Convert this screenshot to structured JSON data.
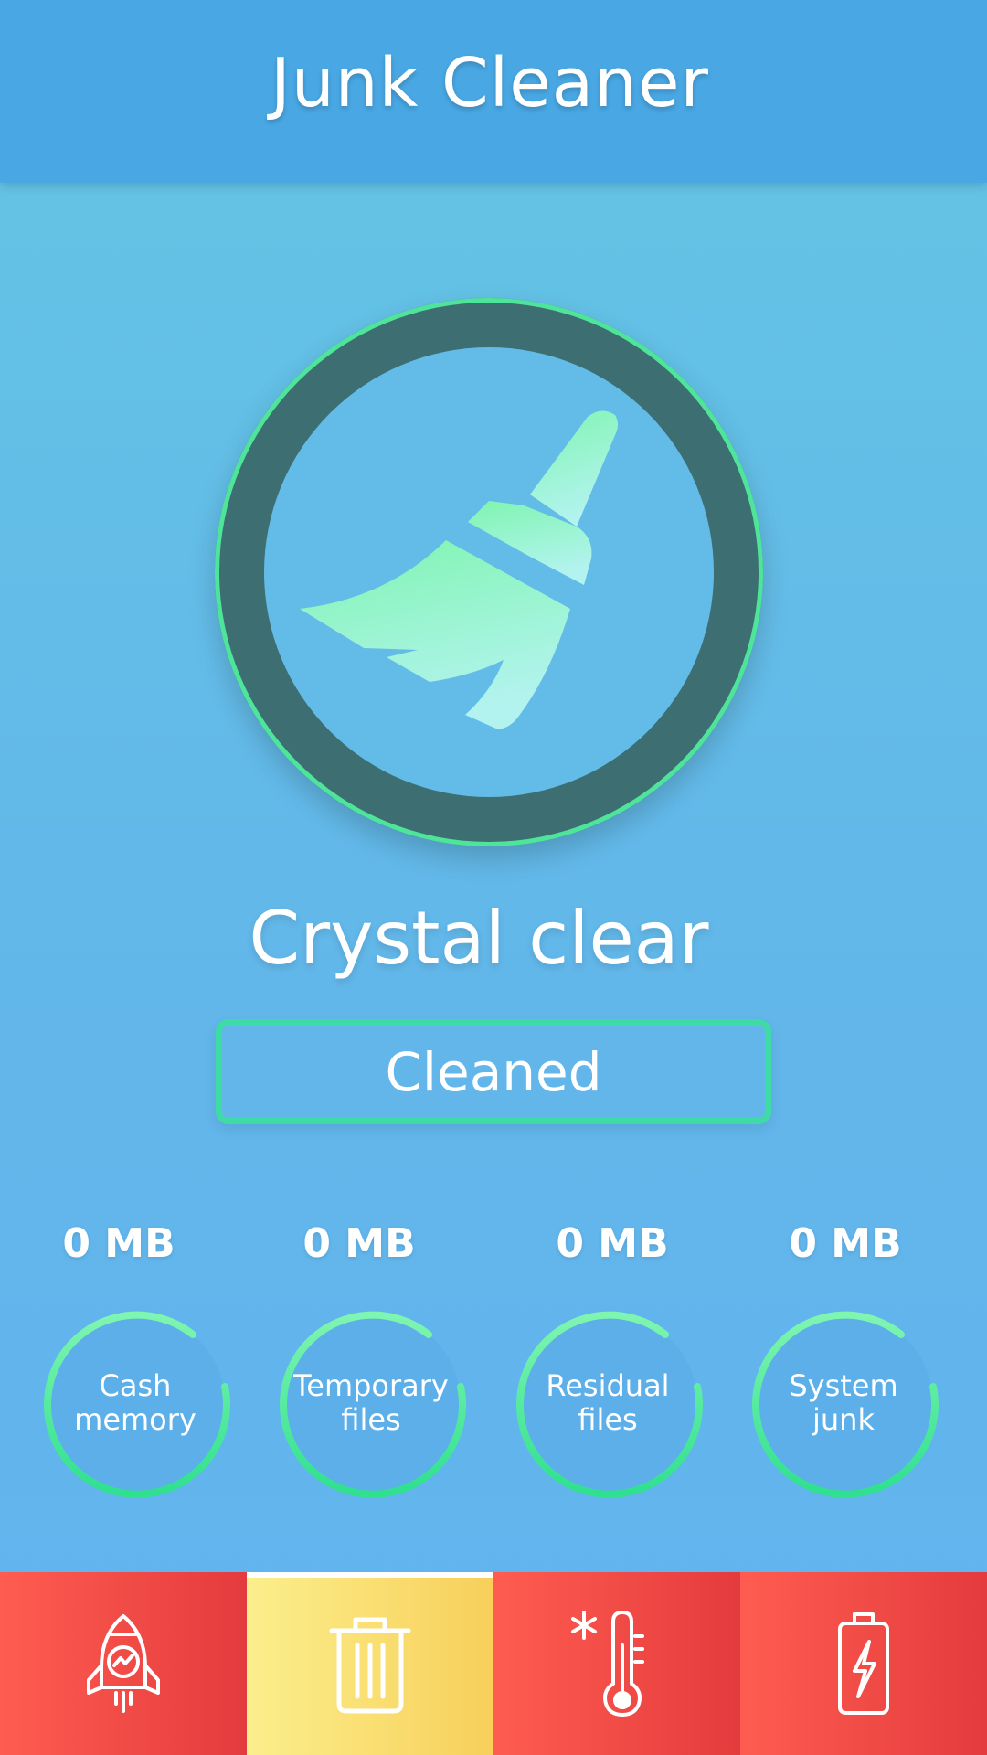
{
  "header": {
    "title": "Junk Cleaner"
  },
  "status": {
    "text": "Crystal clear",
    "button_label": "Cleaned"
  },
  "stats": [
    {
      "value": "0 MB",
      "label_line1": "Cash",
      "label_line2": "memory"
    },
    {
      "value": "0 MB",
      "label_line1": "Temporary",
      "label_line2": "files"
    },
    {
      "value": "0 MB",
      "label_line1": "Residual",
      "label_line2": "files"
    },
    {
      "value": "0 MB",
      "label_line1": "System",
      "label_line2": "junk"
    }
  ],
  "nav": {
    "tabs": [
      {
        "icon": "rocket-icon",
        "active": false
      },
      {
        "icon": "trash-icon",
        "active": true
      },
      {
        "icon": "thermometer-icon",
        "active": false
      },
      {
        "icon": "battery-icon",
        "active": false
      }
    ]
  },
  "colors": {
    "header": "#49a8e4",
    "accent_green": "#4ee59b",
    "ring_dark": "#3d6e72",
    "nav_red": "#e43b3e",
    "nav_active": "#f8cf5a"
  }
}
